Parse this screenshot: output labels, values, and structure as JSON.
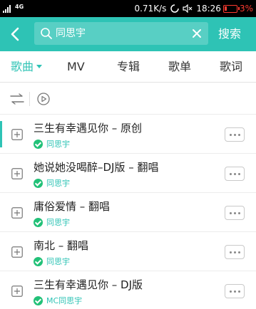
{
  "status_bar": {
    "network": "4G",
    "speed": "0.71K/s",
    "time": "18:26",
    "battery": "3%"
  },
  "search": {
    "query": "同思宇",
    "button_label": "搜索"
  },
  "tabs": [
    {
      "label": "歌曲",
      "active": true
    },
    {
      "label": "MV"
    },
    {
      "label": "专辑"
    },
    {
      "label": "歌单"
    },
    {
      "label": "歌词"
    }
  ],
  "songs": [
    {
      "title": "三生有幸遇见你 – 原创",
      "artist": "同思宇",
      "selected": true
    },
    {
      "title": "她说她没喝醉–DJ版 – 翻唱",
      "artist": "同思宇"
    },
    {
      "title": "庸俗爱情 – 翻唱",
      "artist": "同思宇"
    },
    {
      "title": "南北 – 翻唱",
      "artist": "同思宇"
    },
    {
      "title": "三生有幸遇见你 – DJ版",
      "artist": "MC同思宇"
    }
  ],
  "colors": {
    "accent": "#2ec3b5",
    "verified": "#22c178",
    "battery_low": "#ff3b30"
  }
}
